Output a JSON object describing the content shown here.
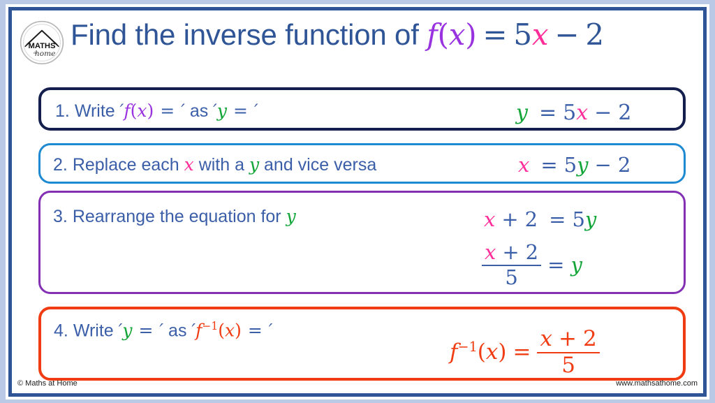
{
  "page": {
    "background_color": "#b9c9e6",
    "frame_color": "#2f5597"
  },
  "logo": {
    "name": "maths-at-home-logo",
    "top_text": "MATHS",
    "bottom_text": "at home"
  },
  "header": {
    "title_prefix": "Find the inverse function of ",
    "title_function": "f",
    "title_paren_open": "(",
    "title_var_x": "x",
    "title_paren_close": ")",
    "title_equals": "=",
    "title_coefficient": "5",
    "title_var_x2": "x",
    "title_minus": "−",
    "title_constant": "2",
    "title_plain": "Find the inverse function of f(x) = 5x − 2"
  },
  "steps": [
    {
      "id": "step1",
      "border_color": "#141f4d",
      "number": "1.",
      "label_text": "Write ",
      "quote_open": "′",
      "label_fx": "f",
      "label_fx_paren_open": "(",
      "label_fx_var": "x",
      "label_fx_paren_close": ")",
      "label_eq1": "=",
      "quote_close": "′",
      "label_as": " as ",
      "label_y": "y",
      "label_eq2": "=",
      "full_label": "1. Write ′f(x) = ′ as ′y = ′",
      "equation": {
        "lhs": "y",
        "equals": "=",
        "coefficient": "5",
        "variable": "x",
        "minus": "−",
        "constant": "2",
        "plain": "y = 5x − 2"
      }
    },
    {
      "id": "step2",
      "border_color": "#1f8ad2",
      "number": "2.",
      "label_part1": "Replace each ",
      "label_x": "x",
      "label_part2": " with a ",
      "label_y": "y",
      "label_part3": " and vice versa",
      "full_label": "2. Replace each x with a y and vice versa",
      "equation": {
        "lhs": "x",
        "equals": "=",
        "coefficient": "5",
        "variable": "y",
        "minus": "−",
        "constant": "2",
        "plain": "x = 5y − 2"
      }
    },
    {
      "id": "step3",
      "border_color": "#8330b5",
      "number": "3.",
      "label_part1": "Rearrange the equation for ",
      "label_y": "y",
      "full_label": "3. Rearrange the equation for y",
      "equation_a": {
        "variable": "x",
        "plus": "+",
        "constant": "2",
        "equals": "=",
        "coefficient": "5",
        "rhs": "y",
        "plain": "x + 2 = 5y"
      },
      "equation_b": {
        "numerator_var": "x",
        "numerator_plus": "+",
        "numerator_const": "2",
        "denominator": "5",
        "equals": "=",
        "rhs": "y",
        "plain": "(x + 2)/5 = y"
      }
    },
    {
      "id": "step4",
      "border_color": "#f03c13",
      "number": "4.",
      "label_write": "Write ",
      "label_y": "y",
      "label_eq1": "=",
      "label_as": " as ",
      "label_f": "f",
      "label_inv": "−1",
      "label_paren_open": "(",
      "label_var": "x",
      "label_paren_close": ")",
      "label_eq2": "=",
      "full_label": "4. Write ′y = ′ as ′f⁻¹(x) = ′",
      "equation": {
        "f": "f",
        "inverse": "−1",
        "paren_open": "(",
        "variable": "x",
        "paren_close": ")",
        "equals": "=",
        "numerator_var": "x",
        "numerator_plus": "+",
        "numerator_const": "2",
        "denominator": "5",
        "plain": "f⁻¹(x) = (x + 2)/5"
      }
    }
  ],
  "footer": {
    "copyright": "© Maths at Home",
    "website": "www.mathsathome.com"
  },
  "colors": {
    "title_blue": "#2f5597",
    "text_navy": "#3b5ea8",
    "var_x_pink": "#ff2e9a",
    "var_y_green": "#13a538",
    "function_purple": "#9933e0",
    "inverse_red": "#f03c13"
  }
}
